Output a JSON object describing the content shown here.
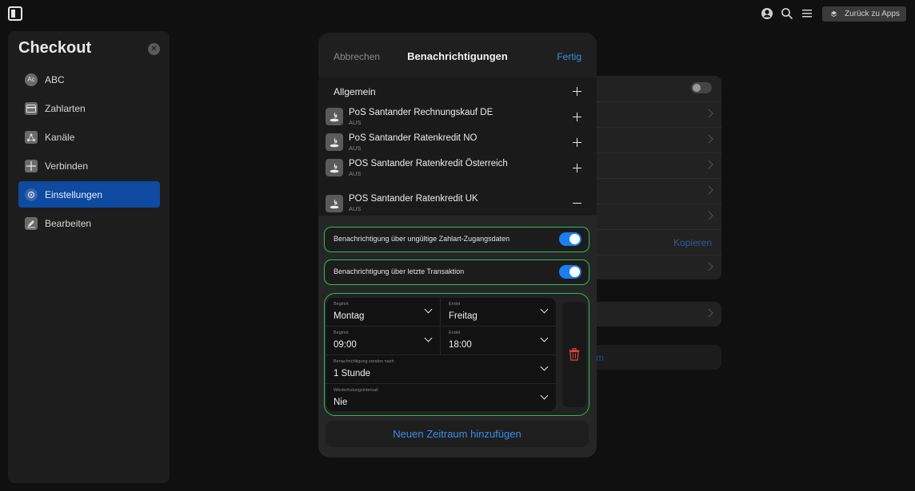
{
  "topbar": {
    "back_label": "Zurück zu Apps"
  },
  "sidebar": {
    "title": "Checkout",
    "items": [
      {
        "label": "ABC",
        "icon": "ac-avatar-icon"
      },
      {
        "label": "Zahlarten",
        "icon": "credit-card-icon"
      },
      {
        "label": "Kanäle",
        "icon": "network-icon"
      },
      {
        "label": "Verbinden",
        "icon": "plus-grid-icon"
      },
      {
        "label": "Einstellungen",
        "icon": "gear-icon",
        "active": true
      },
      {
        "label": "Bearbeiten",
        "icon": "edit-icon"
      }
    ],
    "abc_avatar": "Ac"
  },
  "background": {
    "copy_label": "Kopieren",
    "partial_text": "m"
  },
  "modal": {
    "cancel_label": "Abbrechen",
    "title": "Benachrichtigungen",
    "done_label": "Fertig",
    "general_label": "Allgemein",
    "providers": [
      {
        "name": "PoS Santander Rechnungskauf DE",
        "status": "AUS",
        "expanded": false
      },
      {
        "name": "PoS Santander Ratenkredit NO",
        "status": "AUS",
        "expanded": false
      },
      {
        "name": "POS Santander Ratenkredit Österreich",
        "status": "AUS",
        "expanded": false
      },
      {
        "name": "POS Santander Ratenkredit UK",
        "status": "AUS",
        "expanded": true
      }
    ],
    "toggles": [
      {
        "label": "Benachrichtigung über ungültige Zahlart-Zugangsdaten",
        "on": true
      },
      {
        "label": "Benachrichtigung über letzte Transaktion",
        "on": true
      }
    ],
    "schedule": {
      "start_day_label": "Beginnt",
      "start_day": "Montag",
      "end_day_label": "Endet",
      "end_day": "Freitag",
      "start_time_label": "Beginnt",
      "start_time": "09:00",
      "end_time_label": "Endet",
      "end_time": "18:00",
      "send_after_label": "Benachrichtigung senden nach",
      "send_after": "1 Stunde",
      "repeat_label": "Wiederholungsintervall",
      "repeat": "Nie"
    },
    "add_period_label": "Neuen Zeitraum hinzufügen"
  },
  "colors": {
    "accent": "#3a8ee6",
    "active_nav": "#0d4aa0",
    "highlight_border": "#2bbd5b",
    "delete": "#e0453e"
  }
}
